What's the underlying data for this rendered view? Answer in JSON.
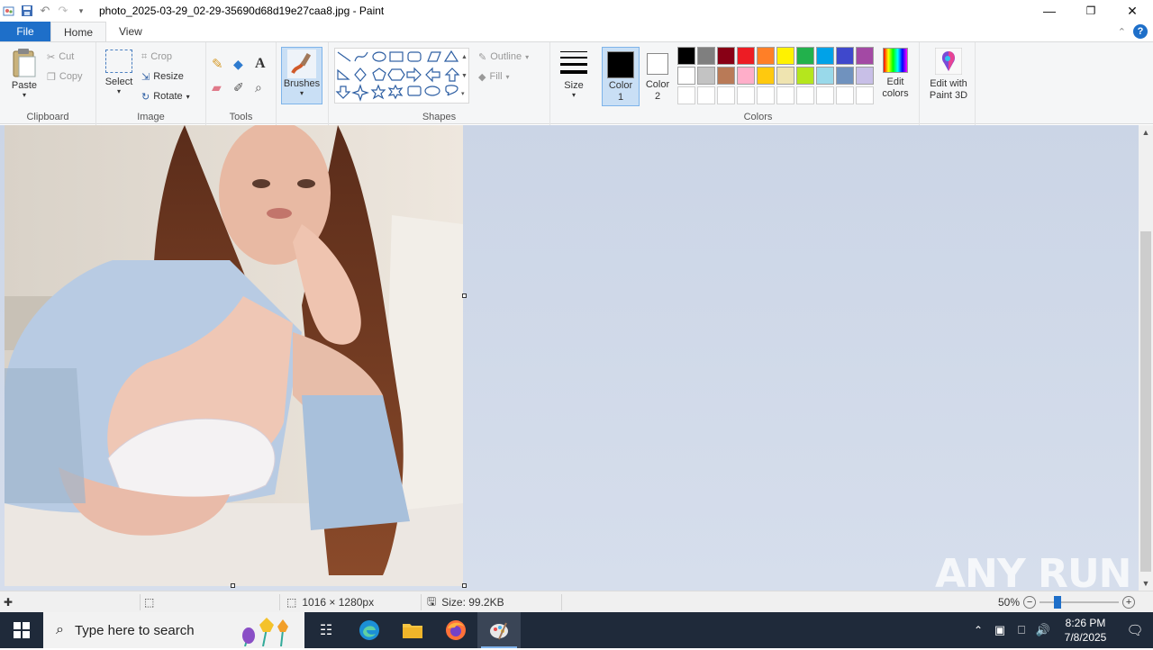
{
  "window": {
    "title": "photo_2025-03-29_02-29-35690d68d19e27caa8.jpg - Paint"
  },
  "tabs": [
    "File",
    "Home",
    "View"
  ],
  "clipboard": {
    "paste": "Paste",
    "cut": "Cut",
    "copy": "Copy",
    "label": "Clipboard"
  },
  "image": {
    "select": "Select",
    "crop": "Crop",
    "resize": "Resize",
    "rotate": "Rotate",
    "label": "Image"
  },
  "tools": {
    "label": "Tools"
  },
  "brushes": {
    "label": "Brushes"
  },
  "shapes": {
    "label": "Shapes",
    "outline": "Outline",
    "fill": "Fill"
  },
  "size": {
    "label": "Size"
  },
  "colors": {
    "color1": "Color 1",
    "color2": "Color 2",
    "edit": "Edit colors",
    "label": "Colors",
    "palette_row1": [
      "#000000",
      "#7f7f7f",
      "#880015",
      "#ed1c24",
      "#ff7f27",
      "#fff200",
      "#22b14c",
      "#00a2e8",
      "#3f48cc",
      "#a349a4"
    ],
    "palette_row2": [
      "#ffffff",
      "#c3c3c3",
      "#b97a57",
      "#ffaec9",
      "#ffc90e",
      "#efe4b0",
      "#b5e61d",
      "#99d9ea",
      "#7092be",
      "#c8bfe7"
    ]
  },
  "paint3d": {
    "label": "Edit with Paint 3D"
  },
  "status": {
    "dimensions": "1016 × 1280px",
    "size": "Size: 99.2KB",
    "zoom": "50%"
  },
  "watermark": "ANY RUN",
  "taskbar": {
    "search_placeholder": "Type here to search",
    "time": "8:26 PM",
    "date": "7/8/2025"
  }
}
